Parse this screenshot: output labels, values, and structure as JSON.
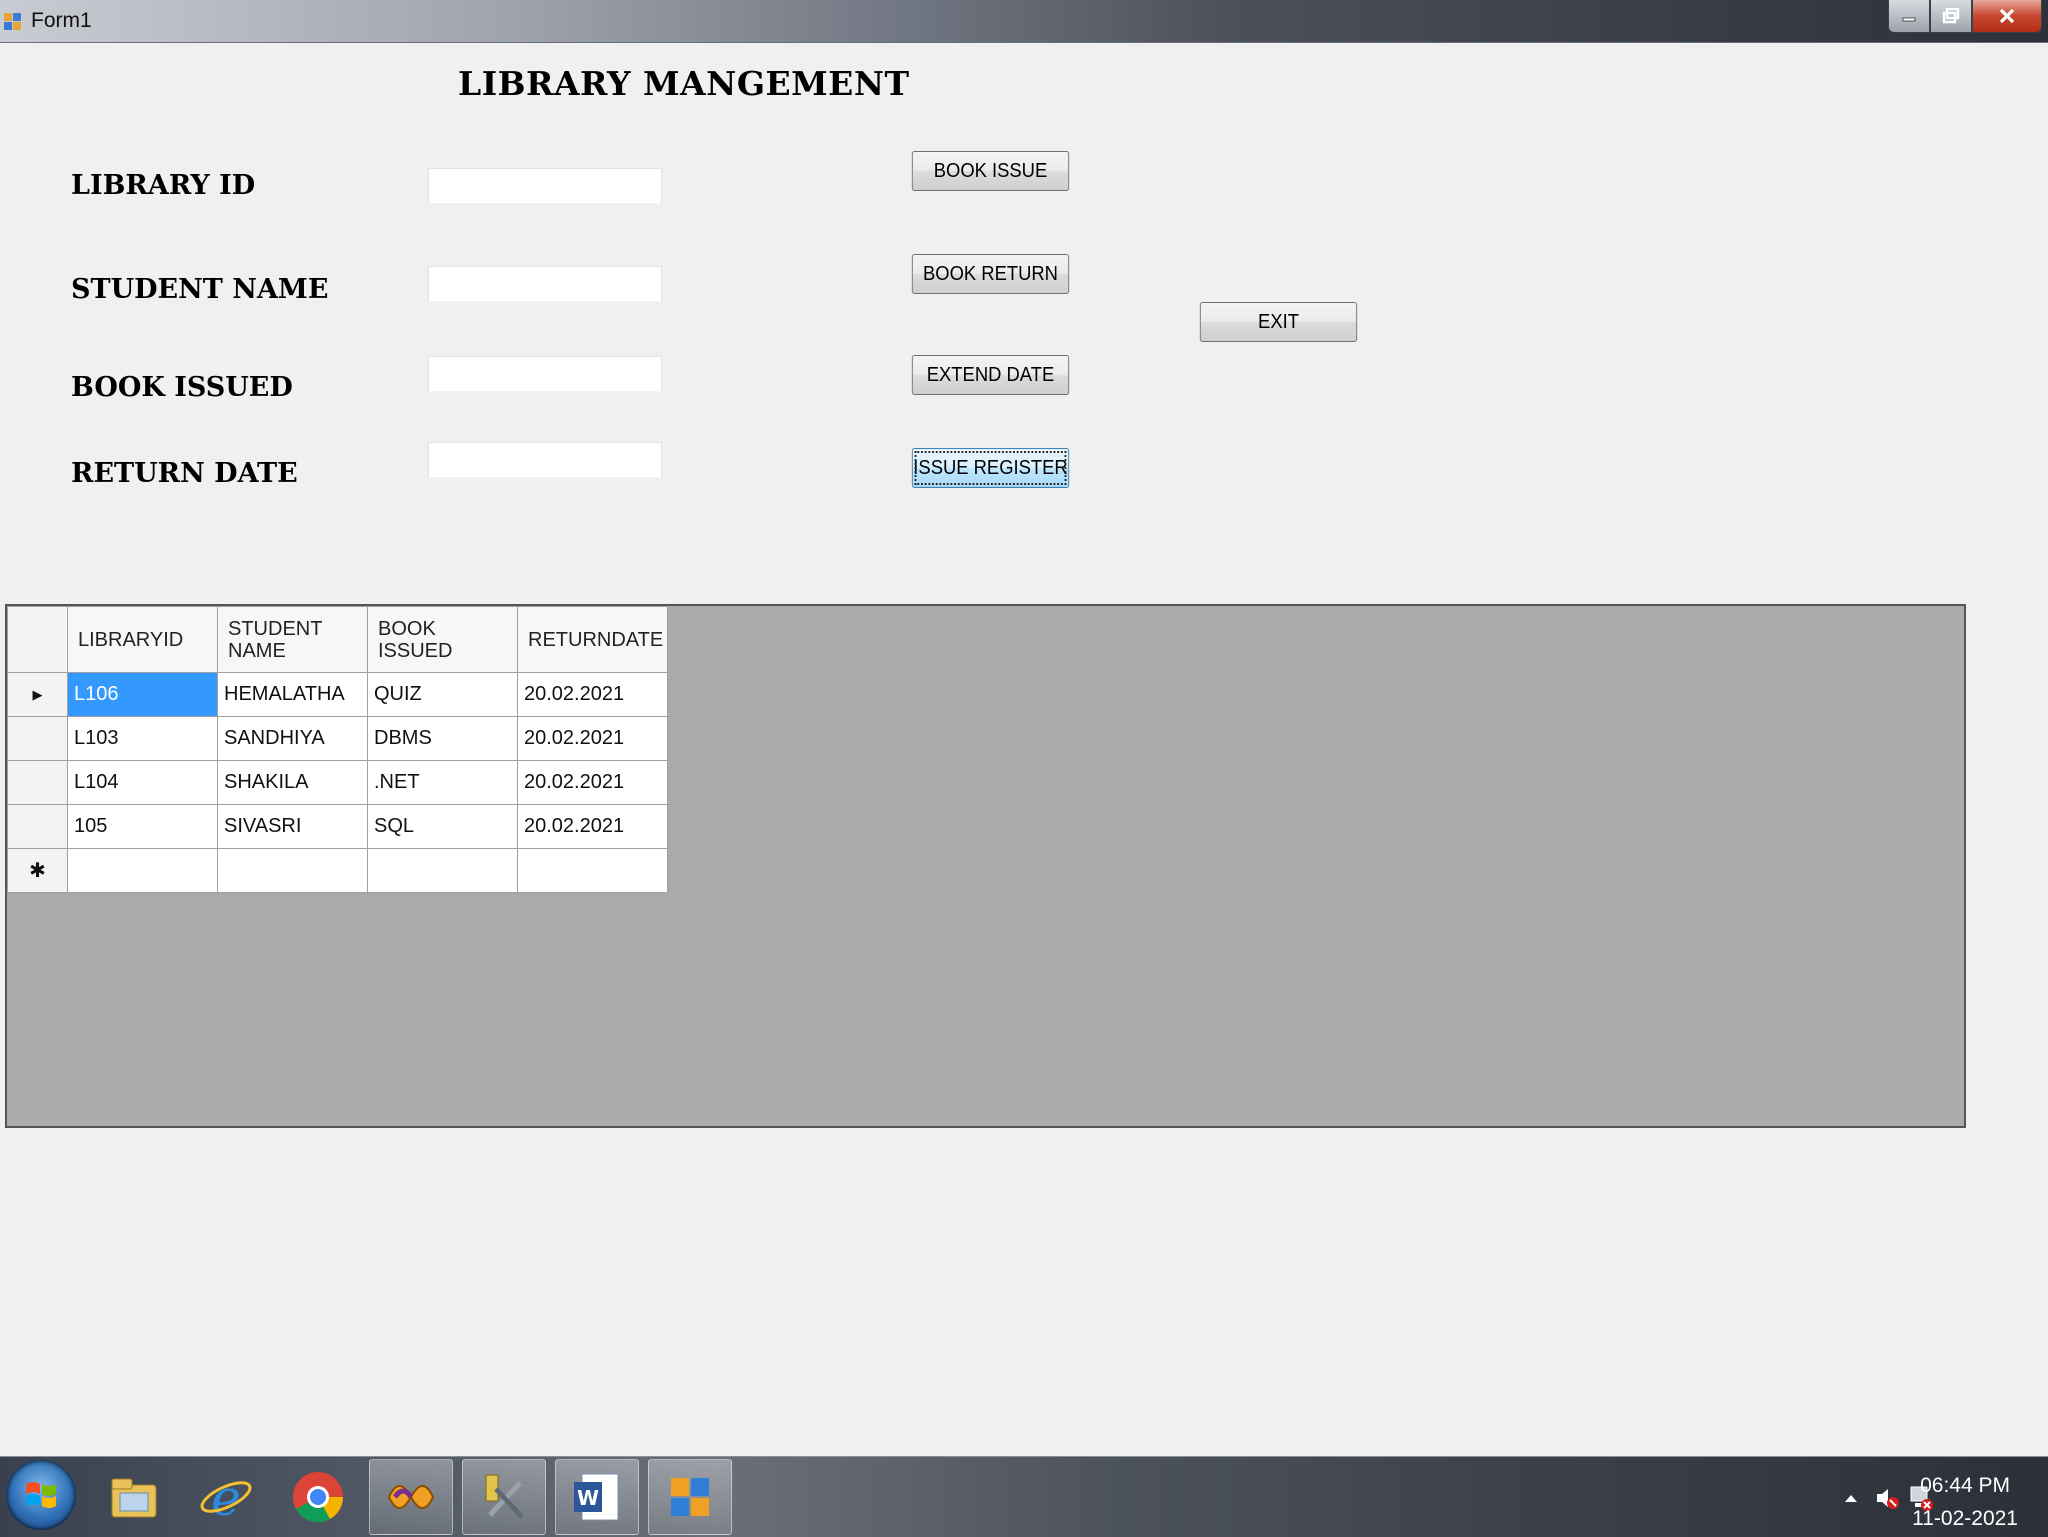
{
  "window": {
    "title": "Form1"
  },
  "form": {
    "heading": "LIBRARY MANGEMENT",
    "fields": [
      {
        "label": "LIBRARY ID",
        "value": ""
      },
      {
        "label": "STUDENT NAME",
        "value": ""
      },
      {
        "label": "BOOK ISSUED",
        "value": ""
      },
      {
        "label": "RETURN DATE",
        "value": ""
      }
    ],
    "buttons": {
      "book_issue": "BOOK ISSUE",
      "book_return": "BOOK RETURN",
      "extend_date": "EXTEND DATE",
      "issue_register": "ISSUE REGISTER",
      "exit": "EXIT"
    }
  },
  "grid": {
    "columns": [
      "LIBRARYID",
      "STUDENT NAME",
      "BOOK ISSUED",
      "RETURNDATE"
    ],
    "rows": [
      [
        "L106",
        "HEMALATHA",
        "QUIZ",
        "20.02.2021"
      ],
      [
        "L103",
        "SANDHIYA",
        "DBMS",
        "20.02.2021"
      ],
      [
        "L104",
        "SHAKILA",
        ".NET",
        "20.02.2021"
      ],
      [
        "105",
        "SIVASRI",
        "SQL",
        "20.02.2021"
      ]
    ],
    "current_row_marker": "▶",
    "new_row_marker": "✱"
  },
  "taskbar": {
    "apps": [
      "explorer-icon",
      "internet-explorer-icon",
      "chrome-icon",
      "visual-studio-icon",
      "tools-icon",
      "word-icon",
      "form-app-icon"
    ],
    "clock": {
      "time": "06:44 PM",
      "date": "11-02-2021"
    }
  },
  "colors": {
    "selection": "#3399ff",
    "grid_background": "#ababab",
    "form_background": "#f0f0f0"
  }
}
